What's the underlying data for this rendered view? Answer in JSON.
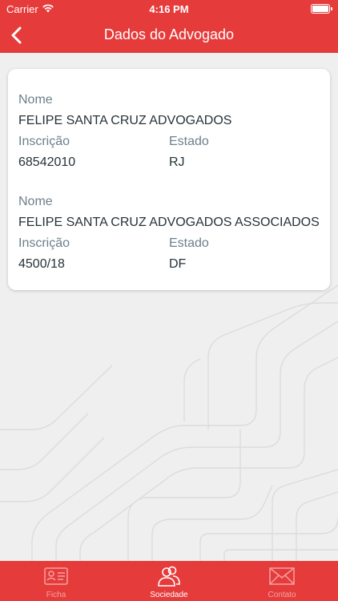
{
  "status_bar": {
    "carrier": "Carrier",
    "time": "4:16 PM"
  },
  "nav": {
    "title": "Dados do Advogado",
    "back_icon": "chevron-left-icon"
  },
  "entries": [
    {
      "nome_label": "Nome",
      "nome": "FELIPE SANTA CRUZ ADVOGADOS",
      "inscricao_label": "Inscrição",
      "inscricao": "68542010",
      "estado_label": "Estado",
      "estado": "RJ"
    },
    {
      "nome_label": "Nome",
      "nome": "FELIPE SANTA CRUZ ADVOGADOS ASSOCIADOS",
      "inscricao_label": "Inscrição",
      "inscricao": "4500/18",
      "estado_label": "Estado",
      "estado": "DF"
    }
  ],
  "tabs": [
    {
      "label": "Ficha",
      "icon": "id-card-icon",
      "active": false
    },
    {
      "label": "Sociedade",
      "icon": "users-icon",
      "active": true
    },
    {
      "label": "Contato",
      "icon": "envelope-icon",
      "active": false
    }
  ],
  "colors": {
    "primary": "#e63b3b",
    "label": "#6e7f8a",
    "value": "#263238"
  }
}
